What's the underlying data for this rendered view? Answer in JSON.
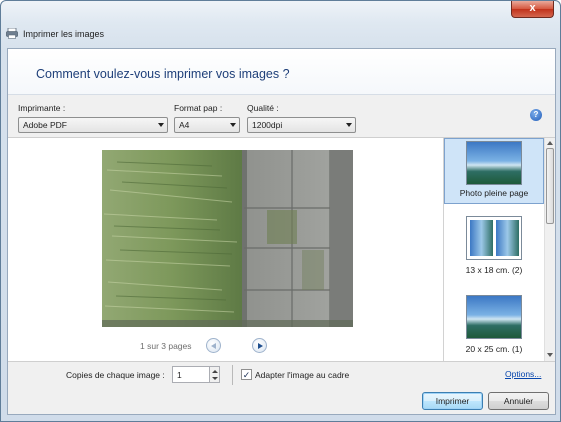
{
  "window": {
    "title": "Imprimer les images",
    "close_glyph": "x"
  },
  "header": {
    "question": "Comment voulez-vous imprimer vos images ?"
  },
  "options": {
    "printer_label": "Imprimante :",
    "printer_value": "Adobe PDF",
    "paper_label": "Format pap :",
    "paper_value": "A4",
    "quality_label": "Qualité :",
    "quality_value": "1200dpi",
    "help_glyph": "?"
  },
  "preview": {
    "pager_text": "1 sur 3 pages"
  },
  "layouts": [
    {
      "label": "Photo pleine page",
      "selected": true
    },
    {
      "label": "13 x 18 cm. (2)",
      "selected": false
    },
    {
      "label": "20 x 25 cm. (1)",
      "selected": false
    }
  ],
  "copies": {
    "label": "Copies de chaque image :",
    "value": "1",
    "fit_label": "Adapter l'image au cadre",
    "fit_checked": true,
    "check_glyph": "✓",
    "options_link": "Options..."
  },
  "buttons": {
    "print": "Imprimer",
    "cancel": "Annuler"
  },
  "colors": {
    "header_text": "#1e3f79",
    "link": "#0645ad",
    "close_button": "#c1321b"
  }
}
